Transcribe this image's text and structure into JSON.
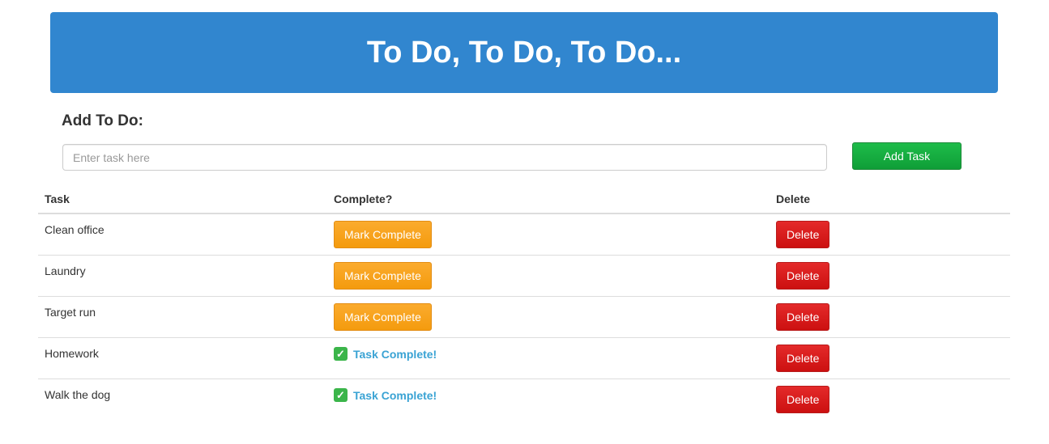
{
  "header": {
    "title": "To Do, To Do, To Do..."
  },
  "add_form": {
    "label": "Add To Do:",
    "input_placeholder": "Enter task here",
    "input_value": "",
    "button_label": "Add Task"
  },
  "table": {
    "columns": [
      "Task",
      "Complete?",
      "Delete"
    ],
    "rows": [
      {
        "task": "Clean office",
        "complete": false,
        "action_label": "Mark Complete",
        "delete_label": "Delete"
      },
      {
        "task": "Laundry",
        "complete": false,
        "action_label": "Mark Complete",
        "delete_label": "Delete"
      },
      {
        "task": "Target run",
        "complete": false,
        "action_label": "Mark Complete",
        "delete_label": "Delete"
      },
      {
        "task": "Homework",
        "complete": true,
        "status_label": "Task Complete!",
        "delete_label": "Delete"
      },
      {
        "task": "Walk the dog",
        "complete": true,
        "status_label": "Task Complete!",
        "delete_label": "Delete"
      }
    ]
  },
  "colors": {
    "banner": "#3186cf",
    "add_button": "#0f9e37",
    "mark_complete_button": "#f49b0e",
    "delete_button": "#cc1010",
    "complete_text": "#3aa3d4",
    "check_icon": "#3bb54a"
  },
  "icons": {
    "complete_status": "check-icon"
  }
}
